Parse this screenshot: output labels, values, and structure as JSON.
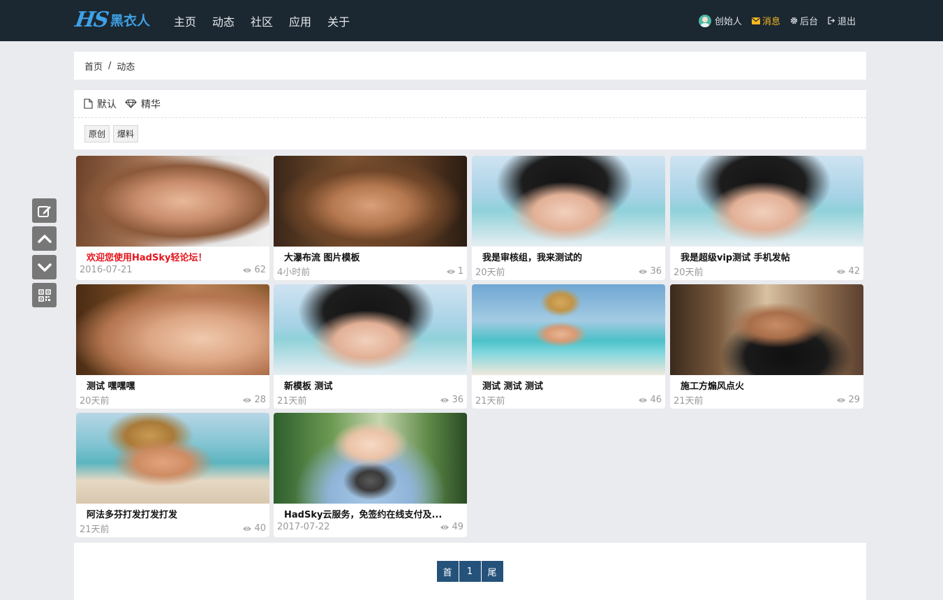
{
  "header": {
    "logo_mark": "HS",
    "logo_text": "黑衣人",
    "nav": [
      "主页",
      "动态",
      "社区",
      "应用",
      "关于"
    ],
    "user_name": "创始人",
    "messages": "消息",
    "admin": "后台",
    "logout": "退出"
  },
  "breadcrumb": {
    "home": "首页",
    "sep": "/",
    "current": "动态"
  },
  "filter": {
    "sort_default": "默认",
    "sort_featured": "精华",
    "tags": [
      "原创",
      "爆料"
    ]
  },
  "cards": [
    {
      "title": "欢迎您使用HadSky轻论坛！",
      "time": "2016-07-21",
      "views": "62"
    },
    {
      "title": "大瀑布流 图片模板",
      "time": "4小时前",
      "views": "1"
    },
    {
      "title": "我是审核组，我来测试的",
      "time": "20天前",
      "views": "36"
    },
    {
      "title": "我是超级vip测试 手机发帖",
      "time": "20天前",
      "views": "42"
    },
    {
      "title": "测试 嘿嘿嘿",
      "time": "20天前",
      "views": "28"
    },
    {
      "title": "新模板 测试",
      "time": "21天前",
      "views": "36"
    },
    {
      "title": "测试 测试 测试",
      "time": "21天前",
      "views": "46"
    },
    {
      "title": "施工方煽风点火",
      "time": "21天前",
      "views": "29"
    },
    {
      "title": "阿法多芬打发打发打发",
      "time": "21天前",
      "views": "40"
    },
    {
      "title": "HadSky云服务，免签约在线支付及...",
      "time": "2017-07-22",
      "views": "49"
    }
  ],
  "pagination": {
    "first": "首",
    "current": "1",
    "last": "尾"
  }
}
